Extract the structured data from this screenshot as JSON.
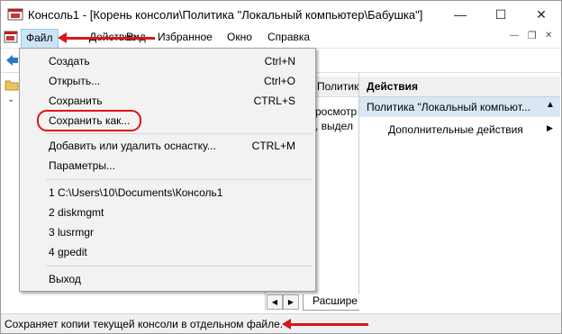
{
  "window": {
    "title": "Консоль1 - [Корень консоли\\Политика \"Локальный компьютер\\Бабушка\"]",
    "minimize_glyph": "—",
    "maximize_glyph": "☐",
    "close_glyph": "✕",
    "icon": "mmc-console-icon"
  },
  "menubar": {
    "items": [
      "Файл",
      "Действие",
      "Вид",
      "Избранное",
      "Окно",
      "Справка"
    ],
    "mdi_min": "—",
    "mdi_restore": "❐",
    "mdi_close": "✕"
  },
  "file_menu": {
    "items": [
      {
        "label": "Создать",
        "shortcut": "Ctrl+N"
      },
      {
        "label": "Открыть...",
        "shortcut": "Ctrl+O"
      },
      {
        "label": "Сохранить",
        "shortcut": "CTRL+S"
      },
      {
        "label": "Сохранить как...",
        "shortcut": ""
      },
      {
        "label": "Добавить или удалить оснастку...",
        "shortcut": "CTRL+M"
      },
      {
        "label": "Параметры...",
        "shortcut": ""
      },
      {
        "label": "1 C:\\Users\\10\\Documents\\Консоль1",
        "shortcut": ""
      },
      {
        "label": "2 diskmgmt",
        "shortcut": ""
      },
      {
        "label": "3 lusrmgr",
        "shortcut": ""
      },
      {
        "label": "4 gpedit",
        "shortcut": ""
      },
      {
        "label": "Выход",
        "shortcut": ""
      }
    ],
    "highlighted_item": "Сохранить как..."
  },
  "center_pane": {
    "header": "Политика \"",
    "text_line1": "росмотр",
    "text_line2": ", выдел",
    "tab_label": "Расшире"
  },
  "actions_pane": {
    "header": "Действия",
    "selected_item": "Политика \"Локальный компьют...",
    "sub_item": "Дополнительные действия"
  },
  "statusbar": {
    "text": "Сохраняет копии текущей консоли в отдельном файле."
  },
  "colors": {
    "annotation_red": "#d9161c",
    "menu_highlight": "#cce4f7",
    "actions_selected": "#d9e7f5"
  }
}
